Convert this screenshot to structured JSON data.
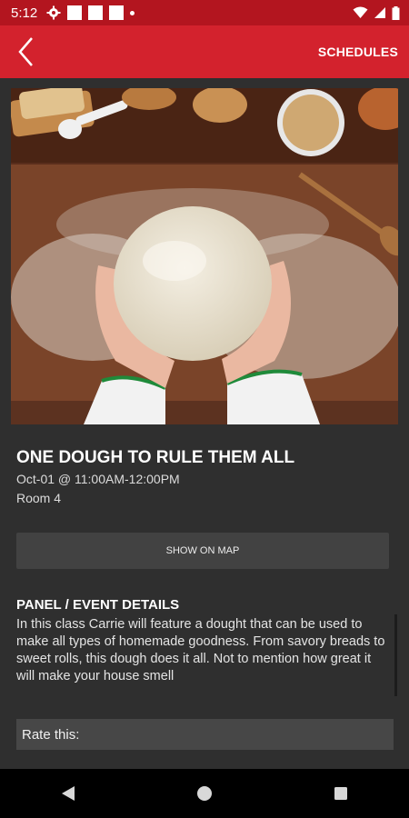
{
  "status": {
    "time": "5:12"
  },
  "appbar": {
    "schedules_label": "SCHEDULES"
  },
  "event": {
    "title": "ONE DOUGH TO RULE THEM ALL",
    "when": "Oct-01 @ 11:00AM-12:00PM",
    "room": "Room 4",
    "map_button": "SHOW ON MAP"
  },
  "details": {
    "heading": "PANEL / EVENT DETAILS",
    "body": "In this class Carrie will feature a dought that can be used to make all types of homemade goodness. From savory breads to sweet rolls, this dough does it all. Not to mention how great it will make your house smell"
  },
  "rating": {
    "label": "Rate this:"
  }
}
